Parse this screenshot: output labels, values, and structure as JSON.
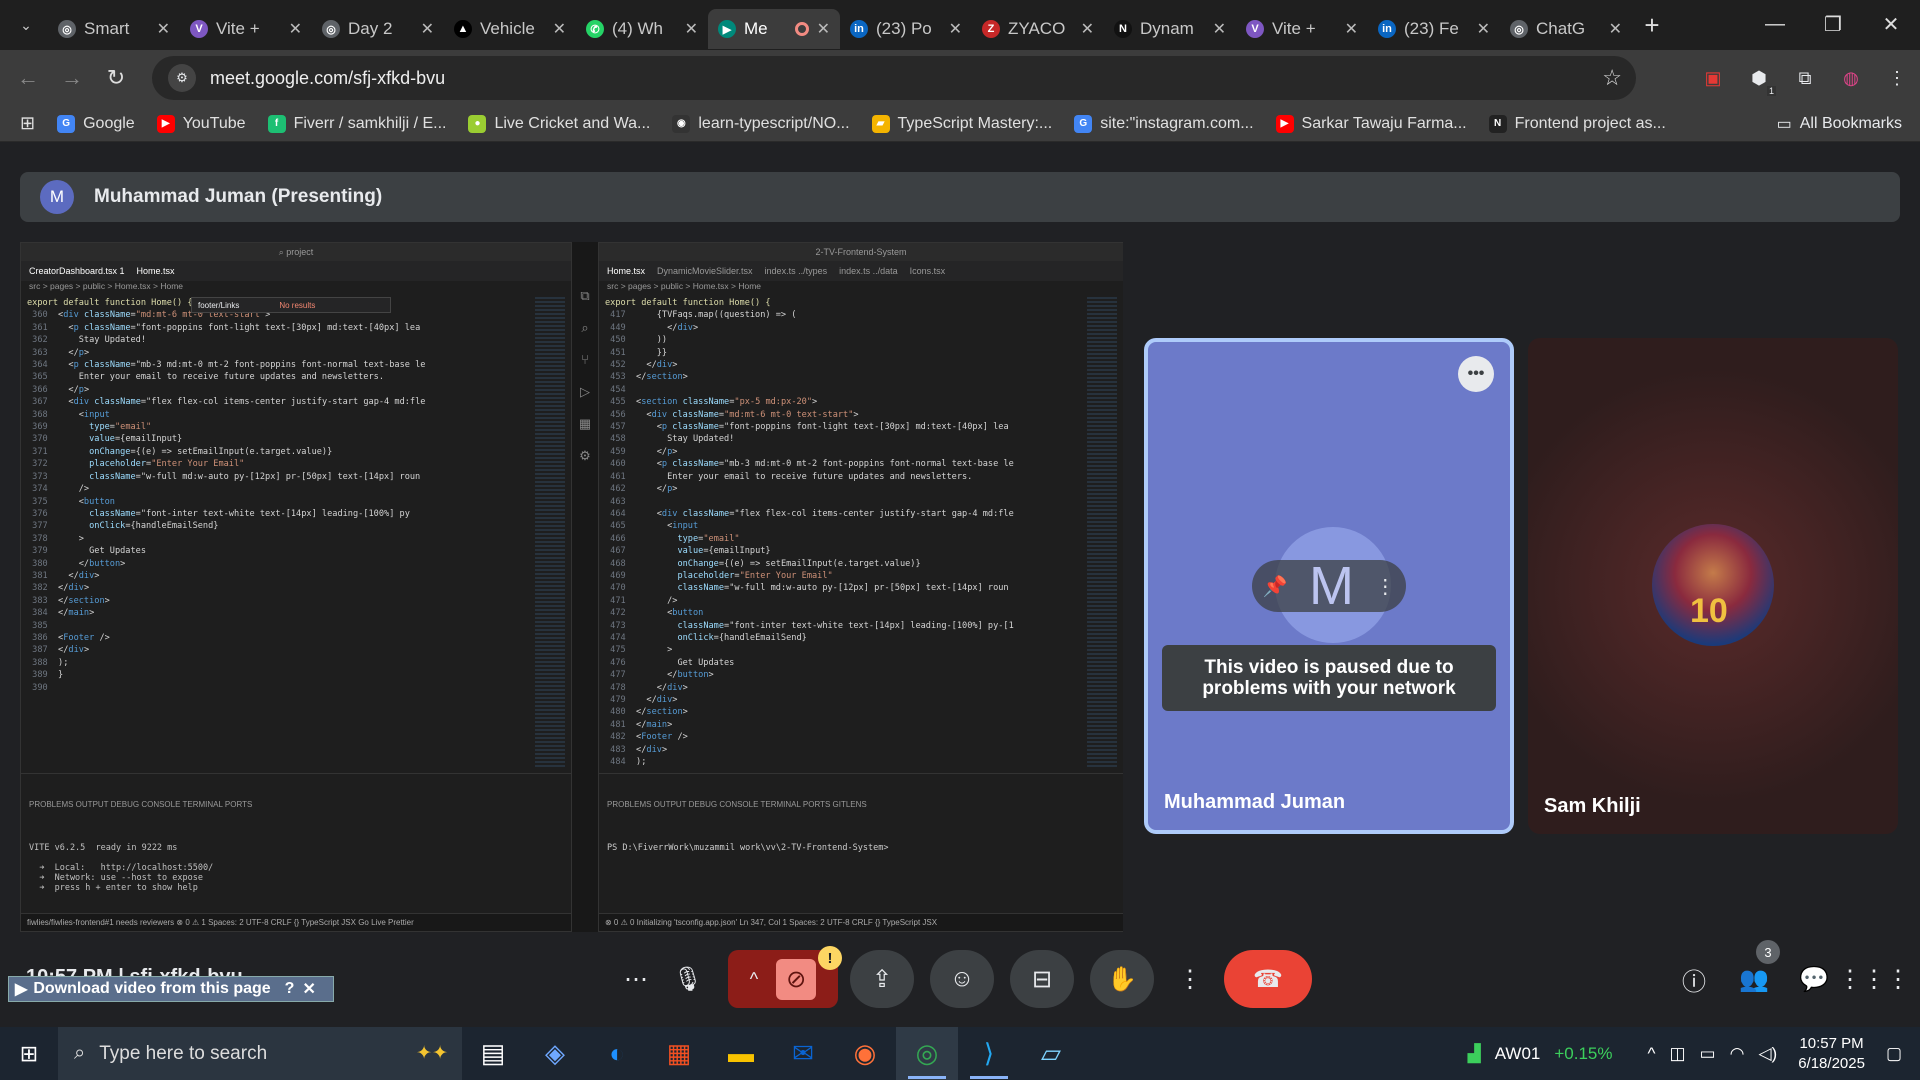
{
  "browser": {
    "tabs": [
      {
        "title": "Smart",
        "color": "#5f6368",
        "glyph": "◎"
      },
      {
        "title": "Vite +",
        "color": "#7e57c2",
        "glyph": "V"
      },
      {
        "title": "Day 2",
        "color": "#5f6368",
        "glyph": "◎"
      },
      {
        "title": "Vehicle",
        "color": "#000000",
        "glyph": "▲"
      },
      {
        "title": "(4) Wh",
        "color": "#25d366",
        "glyph": "✆"
      },
      {
        "title": "Me",
        "color": "#00897b",
        "glyph": "▶",
        "active": true
      },
      {
        "title": "(23) Po",
        "color": "#0a66c2",
        "glyph": "in"
      },
      {
        "title": "ZYACO",
        "color": "#c62828",
        "glyph": "Z"
      },
      {
        "title": "Dynam",
        "color": "#111111",
        "glyph": "N"
      },
      {
        "title": "Vite +",
        "color": "#7e57c2",
        "glyph": "V"
      },
      {
        "title": "(23) Fe",
        "color": "#0a66c2",
        "glyph": "in"
      },
      {
        "title": "ChatG",
        "color": "#5f6368",
        "glyph": "◎"
      }
    ],
    "url": "meet.google.com/sfj-xfkd-bvu",
    "bookmarks": [
      {
        "label": "Google",
        "color": "#4285f4",
        "glyph": "G"
      },
      {
        "label": "YouTube",
        "color": "#ff0000",
        "glyph": "▶"
      },
      {
        "label": "Fiverr / samkhilji / E...",
        "color": "#1dbf73",
        "glyph": "f"
      },
      {
        "label": "Live Cricket and Wa...",
        "color": "#9acd32",
        "glyph": "●"
      },
      {
        "label": "learn-typescript/NO...",
        "color": "#333333",
        "glyph": "◉"
      },
      {
        "label": "TypeScript Mastery:...",
        "color": "#f4b400",
        "glyph": "▰"
      },
      {
        "label": "site:\"instagram.com...",
        "color": "#4285f4",
        "glyph": "G"
      },
      {
        "label": "Sarkar Tawaju Farma...",
        "color": "#ff0000",
        "glyph": "▶"
      },
      {
        "label": "Frontend project as...",
        "color": "#222222",
        "glyph": "N"
      }
    ],
    "all_bookmarks": "All Bookmarks",
    "ext_badge": "1"
  },
  "meet": {
    "presenter_initial": "M",
    "presenter_banner": "Muhammad Juman (Presenting)",
    "tile1_name": "Muhammad Juman",
    "tile1_initial": "M",
    "paused_message": "This video is paused due to problems with your network",
    "tile2_name": "Sam Khilji",
    "jersey_number": "10",
    "people_count": "3",
    "time_code": "10:57 PM | sfj-xfkd-bvu",
    "download_bar": "Download video from this page"
  },
  "vscode_left": {
    "tabs": [
      "CreatorDashboard.tsx 1",
      "Home.tsx"
    ],
    "breadcrumb": "src > pages > public > Home.tsx > Home",
    "search_text": "footer/Links",
    "search_result": "No results",
    "header_line": "export default function Home() {",
    "code": [
      [
        "360",
        "<div className=\"md:mt-6 mt-0 text-start\">"
      ],
      [
        "361",
        "  <p className=\"font-poppins font-light text-[30px] md:text-[40px] lea"
      ],
      [
        "362",
        "    Stay Updated!"
      ],
      [
        "363",
        "  </p>"
      ],
      [
        "364",
        "  <p className=\"mb-3 md:mt-0 mt-2 font-poppins font-normal text-base le"
      ],
      [
        "365",
        "    Enter your email to receive future updates and newsletters."
      ],
      [
        "366",
        "  </p>"
      ],
      [
        "367",
        "  <div className=\"flex flex-col items-center justify-start gap-4 md:fle"
      ],
      [
        "368",
        "    <input"
      ],
      [
        "369",
        "      type=\"email\""
      ],
      [
        "370",
        "      value={emailInput}"
      ],
      [
        "371",
        "      onChange={(e) => setEmailInput(e.target.value)}"
      ],
      [
        "372",
        "      placeholder=\"Enter Your Email\""
      ],
      [
        "373",
        "      className=\"w-full md:w-auto py-[12px] pr-[50px] text-[14px] roun"
      ],
      [
        "374",
        "    />"
      ],
      [
        "375",
        "    <button"
      ],
      [
        "376",
        "      className=\"font-inter text-white text-[14px] leading-[100%] py"
      ],
      [
        "377",
        "      onClick={handleEmailSend}"
      ],
      [
        "378",
        "    >"
      ],
      [
        "379",
        "      Get Updates"
      ],
      [
        "380",
        "    </button>"
      ],
      [
        "381",
        "  </div>"
      ],
      [
        "382",
        "</div>"
      ],
      [
        "383",
        "</section>"
      ],
      [
        "384",
        "</main>"
      ],
      [
        "385",
        ""
      ],
      [
        "386",
        "<Footer />"
      ],
      [
        "387",
        "</div>"
      ],
      [
        "388",
        ");"
      ],
      [
        "389",
        "}"
      ],
      [
        "390",
        ""
      ]
    ],
    "term_tabs": "PROBLEMS   OUTPUT   DEBUG CONSOLE   TERMINAL   PORTS",
    "terminal": "VITE v6.2.5  ready in 9222 ms\n\n  ➜  Local:   http://localhost:5500/\n  ➜  Network: use --host to expose\n  ➜  press h + enter to show help",
    "status": "fiwlies/fiwlies-frontend#1 needs reviewers   ⊗ 0 ⚠ 1   Spaces: 2   UTF-8   CRLF   {} TypeScript JSX   Go Live   Prettier"
  },
  "vscode_right": {
    "title": "2-TV-Frontend-System",
    "tabs": [
      "Home.tsx",
      "DynamicMovieSlider.tsx",
      "index.ts ../types",
      "index.ts ../data",
      "Icons.tsx"
    ],
    "breadcrumb": "src > pages > public > Home.tsx > Home",
    "header_line": "export default function Home() {",
    "code": [
      [
        "417",
        "    {TVFaqs.map((question) => ("
      ],
      [
        "449",
        "      </div>"
      ],
      [
        "450",
        "    ))"
      ],
      [
        "451",
        "    }}"
      ],
      [
        "452",
        "  </div>"
      ],
      [
        "453",
        "</section>"
      ],
      [
        "454",
        ""
      ],
      [
        "455",
        "<section className=\"px-5 md:px-20\">"
      ],
      [
        "456",
        "  <div className=\"md:mt-6 mt-0 text-start\">"
      ],
      [
        "457",
        "    <p className=\"font-poppins font-light text-[30px] md:text-[40px] lea"
      ],
      [
        "458",
        "      Stay Updated!"
      ],
      [
        "459",
        "    </p>"
      ],
      [
        "460",
        "    <p className=\"mb-3 md:mt-0 mt-2 font-poppins font-normal text-base le"
      ],
      [
        "461",
        "      Enter your email to receive future updates and newsletters."
      ],
      [
        "462",
        "    </p>"
      ],
      [
        "463",
        ""
      ],
      [
        "464",
        "    <div className=\"flex flex-col items-center justify-start gap-4 md:fle"
      ],
      [
        "465",
        "      <input"
      ],
      [
        "466",
        "        type=\"email\""
      ],
      [
        "467",
        "        value={emailInput}"
      ],
      [
        "468",
        "        onChange={(e) => setEmailInput(e.target.value)}"
      ],
      [
        "469",
        "        placeholder=\"Enter Your Email\""
      ],
      [
        "470",
        "        className=\"w-full md:w-auto py-[12px] pr-[50px] text-[14px] roun"
      ],
      [
        "471",
        "      />"
      ],
      [
        "472",
        "      <button"
      ],
      [
        "473",
        "        className=\"font-inter text-white text-[14px] leading-[100%] py-[1"
      ],
      [
        "474",
        "        onClick={handleEmailSend}"
      ],
      [
        "475",
        "      >"
      ],
      [
        "476",
        "        Get Updates"
      ],
      [
        "477",
        "      </button>"
      ],
      [
        "478",
        "    </div>"
      ],
      [
        "479",
        "  </div>"
      ],
      [
        "480",
        "</section>"
      ],
      [
        "481",
        "</main>"
      ],
      [
        "482",
        "<Footer />"
      ],
      [
        "483",
        "</div>"
      ],
      [
        "484",
        ");"
      ],
      [
        "485",
        ""
      ]
    ],
    "term_tabs": "PROBLEMS   OUTPUT   DEBUG CONSOLE   TERMINAL   PORTS   GITLENS",
    "terminal": "PS D:\\FiverrWork\\muzammil work\\vv\\2-TV-Frontend-System>",
    "status": "⊗ 0 ⚠ 0   Initializing 'tsconfig.app.json'        Ln 347, Col 1   Spaces: 2   UTF-8   CRLF   {} TypeScript JSX"
  },
  "taskbar": {
    "search_placeholder": "Type here to search",
    "stock": "AW01",
    "stock_change": "+0.15%",
    "time": "10:57 PM",
    "date": "6/18/2025"
  }
}
